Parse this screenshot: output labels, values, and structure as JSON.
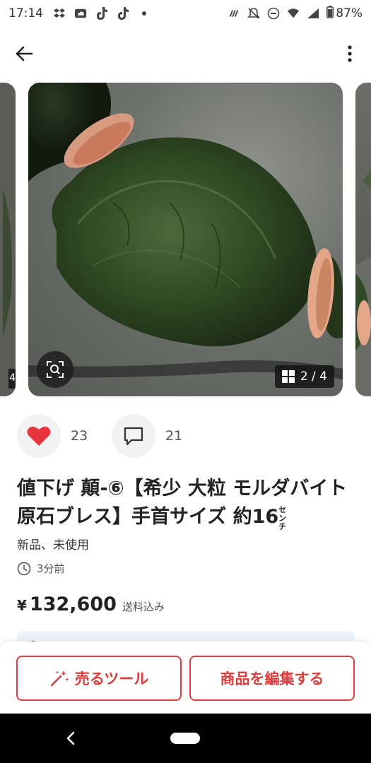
{
  "status_bar": {
    "time": "17:14",
    "left_icons": [
      "dropbox-icon",
      "cloud-icon",
      "tiktok-icon",
      "tiktok-icon",
      "dot-icon"
    ],
    "right_icons": [
      "nfc-icon",
      "mute-icon",
      "dnd-icon",
      "wifi-icon",
      "signal-icon",
      "battery-icon"
    ],
    "battery": "87%"
  },
  "carousel": {
    "counter": "2 / 4",
    "prev_counter_stub": "4"
  },
  "reactions": {
    "likes": "23",
    "comments": "21"
  },
  "item": {
    "title": "値下げ 顛-⑥【希少 大粒 モルダバイト 原石ブレス】手首サイズ 約16",
    "title_unit": "センチ",
    "condition": "新品、未使用",
    "posted": "3分前",
    "price_symbol": "¥",
    "price": "132,600",
    "shipping": "送料込み"
  },
  "actions": {
    "sell_tool": "売るツール",
    "edit_item": "商品を編集する"
  },
  "colors": {
    "accent": "#e03a3a",
    "heart": "#e8343e",
    "banner": "#eef4fb"
  }
}
